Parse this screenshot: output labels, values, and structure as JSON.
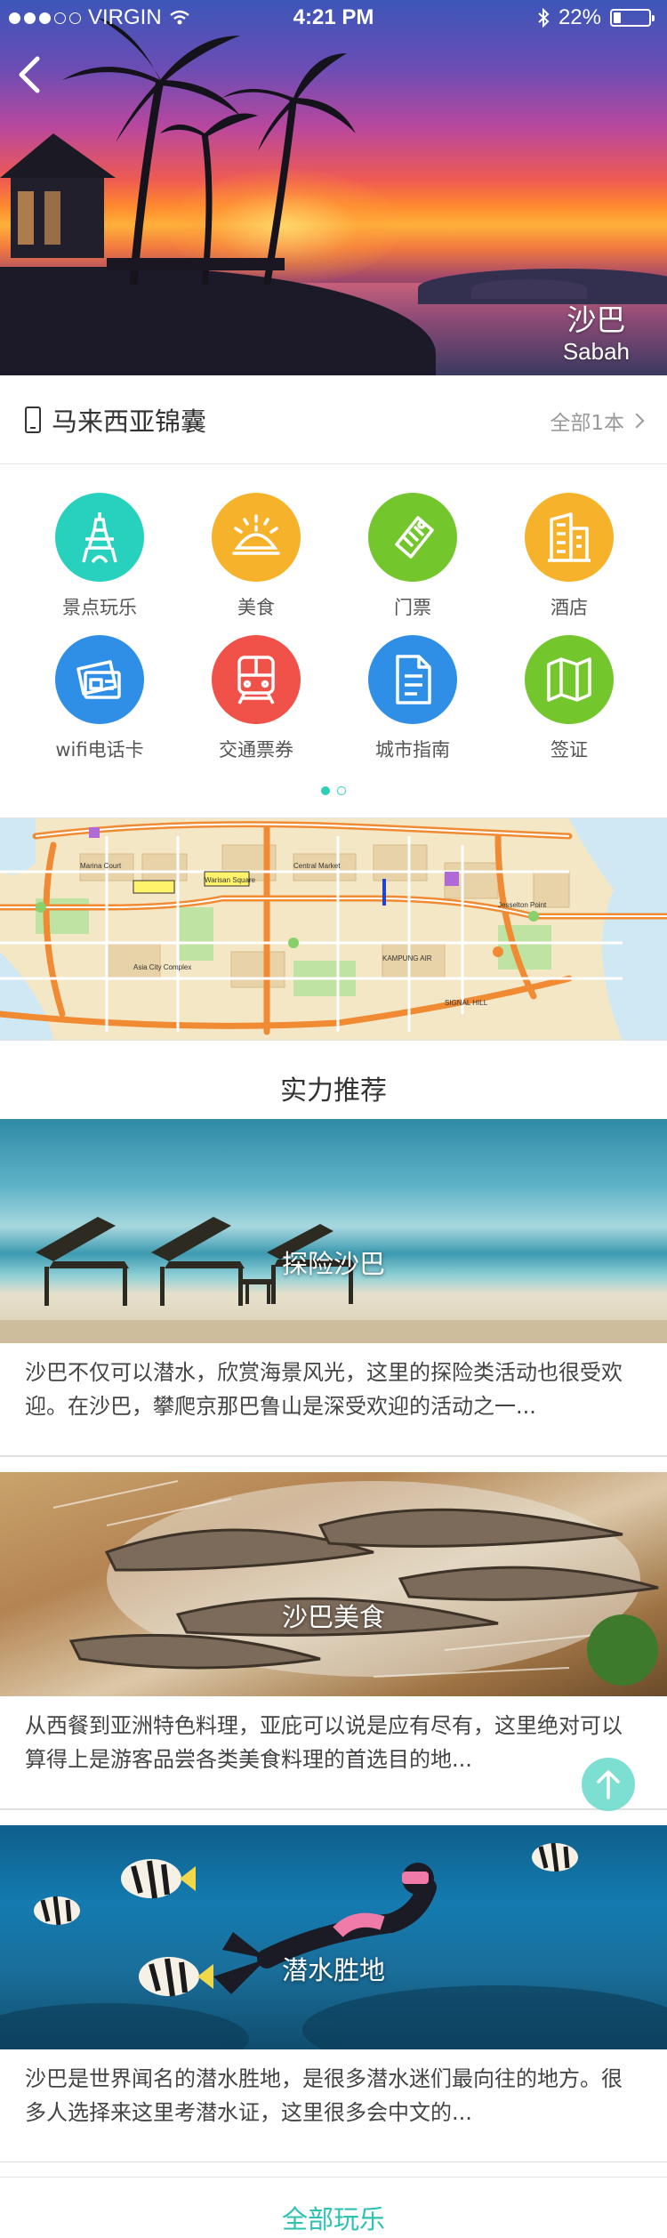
{
  "status_bar": {
    "carrier": "VIRGIN",
    "time": "4:21 PM",
    "battery": "22%",
    "battery_level": 0.22
  },
  "hero": {
    "title_cn": "沙巴",
    "title_en": "Sabah",
    "back_icon": "chevron-left-icon"
  },
  "guide": {
    "title": "马来西亚锦囊",
    "more": "全部1本",
    "icon": "phone-icon"
  },
  "categories": [
    {
      "label": "景点玩乐",
      "icon": "tower-icon",
      "color": "#27d1bd"
    },
    {
      "label": "美食",
      "icon": "food-dome-icon",
      "color": "#f7b22c"
    },
    {
      "label": "门票",
      "icon": "ticket-icon",
      "color": "#73c62c"
    },
    {
      "label": "酒店",
      "icon": "hotel-building-icon",
      "color": "#f7b22c"
    },
    {
      "label": "wifi电话卡",
      "icon": "sim-card-icon",
      "color": "#2f8fe6"
    },
    {
      "label": "交通票券",
      "icon": "train-icon",
      "color": "#f0524a"
    },
    {
      "label": "城市指南",
      "icon": "document-icon",
      "color": "#2f8fe6"
    },
    {
      "label": "签证",
      "icon": "map-icon",
      "color": "#73c62c"
    }
  ],
  "pager": {
    "pages": 2,
    "active": 1
  },
  "recommend": {
    "title": "实力推荐",
    "cards": [
      {
        "title": "探险沙巴",
        "desc": "沙巴不仅可以潜水，欣赏海景风光，这里的探险类活动也很受欢迎。在沙巴，攀爬京那巴鲁山是深受欢迎的活动之一..."
      },
      {
        "title": "沙巴美食",
        "desc": "从西餐到亚洲特色料理，亚庇可以说是应有尽有，这里绝对可以算得上是游客品尝各类美食料理的首选目的地..."
      },
      {
        "title": "潜水胜地",
        "desc": "沙巴是世界闻名的潜水胜地，是很多潜水迷们最向往的地方。很多人选择来这里考潜水证，这里很多会中文的..."
      }
    ],
    "more": "全部玩乐"
  },
  "colors": {
    "accent": "#2fc2b2",
    "divider": "#e3e3e3"
  }
}
